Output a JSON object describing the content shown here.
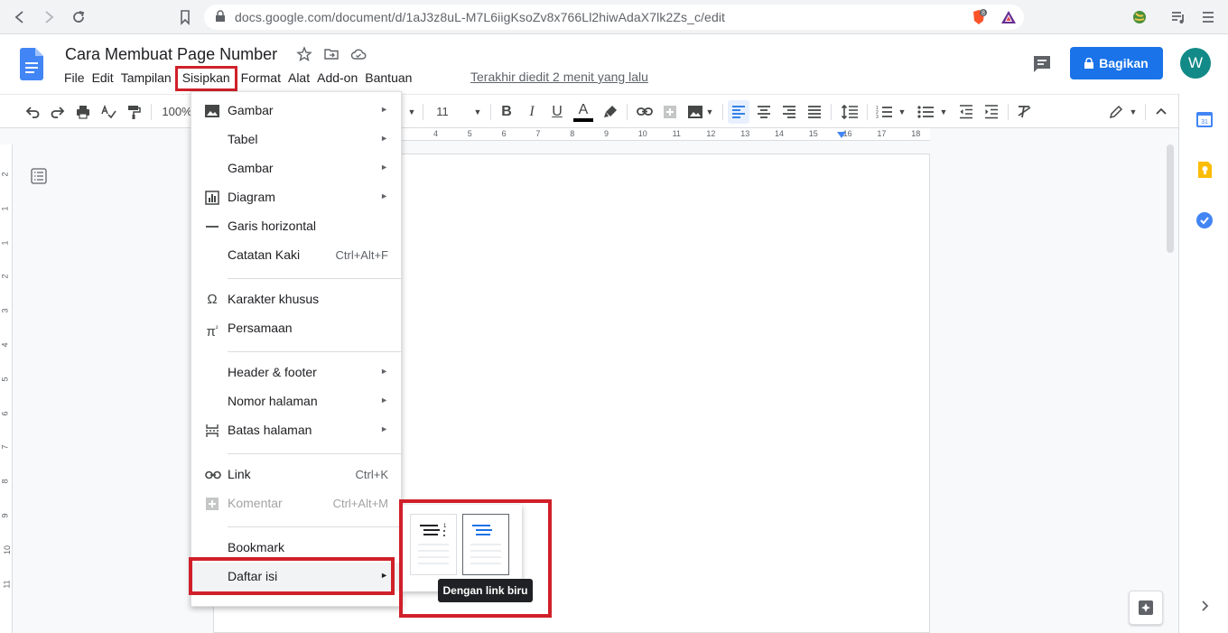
{
  "browser": {
    "url": "docs.google.com/document/d/1aJ3z8uL-M7L6iigKsoZv8x766Ll2hiwAdaX7lk2Zs_c/edit",
    "ext_badge": "8"
  },
  "doc": {
    "title": "Cara Membuat Page Number",
    "last_edit": "Terakhir diedit 2 menit yang lalu",
    "share_label": "Bagikan",
    "avatar_initial": "W"
  },
  "menubar": [
    "File",
    "Edit",
    "Tampilan",
    "Sisipkan",
    "Format",
    "Alat",
    "Add-on",
    "Bantuan"
  ],
  "toolbar": {
    "zoom": "100%",
    "font_size": "11",
    "bold": "B",
    "italic": "I",
    "underline": "U",
    "text_color": "A"
  },
  "ruler": {
    "numbers": [
      "4",
      "5",
      "6",
      "7",
      "8",
      "9",
      "10",
      "11",
      "12",
      "13",
      "14",
      "15",
      "16",
      "17",
      "18"
    ],
    "vertical_numbers": [
      "2",
      "1",
      "1",
      "2",
      "3",
      "4",
      "5",
      "6",
      "7",
      "8",
      "9",
      "10",
      "11"
    ]
  },
  "insert_menu": {
    "items": [
      {
        "label": "Gambar",
        "icon": "image-icon",
        "arrow": "►"
      },
      {
        "label": "Tabel",
        "arrow": "►"
      },
      {
        "label": "Gambar",
        "arrow": "►"
      },
      {
        "label": "Diagram",
        "icon": "chart-icon",
        "arrow": "►"
      },
      {
        "label": "Garis horizontal",
        "icon": "horizontal-line-icon"
      },
      {
        "label": "Catatan Kaki",
        "shortcut": "Ctrl+Alt+F"
      },
      {
        "label": "Karakter khusus",
        "icon": "omega-icon"
      },
      {
        "label": "Persamaan",
        "icon": "pi-icon"
      },
      {
        "label": "Header & footer",
        "arrow": "►"
      },
      {
        "label": "Nomor halaman",
        "arrow": "►"
      },
      {
        "label": "Batas halaman",
        "icon": "page-break-icon",
        "arrow": "►"
      },
      {
        "label": "Link",
        "icon": "link-icon",
        "shortcut": "Ctrl+K"
      },
      {
        "label": "Komentar",
        "icon": "add-comment-icon",
        "shortcut": "Ctrl+Alt+M",
        "disabled": true
      },
      {
        "label": "Bookmark"
      },
      {
        "label": "Daftar isi",
        "arrow": "►"
      }
    ]
  },
  "toc_submenu": {
    "tooltip": "Dengan link biru"
  },
  "colors": {
    "accent_blue": "#1a73e8",
    "highlight_red": "#d0202a",
    "avatar": "#128a87"
  }
}
